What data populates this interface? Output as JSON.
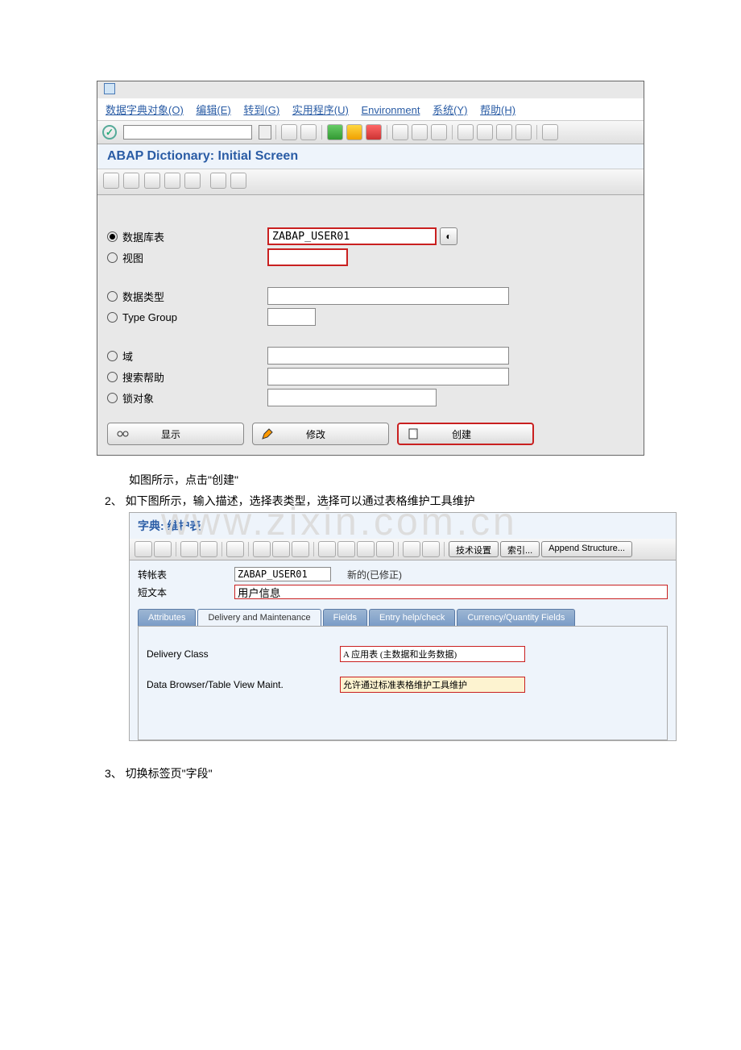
{
  "menubar": {
    "obj": "数据字典对象(O)",
    "edit": "编辑(E)",
    "goto": "转到(G)",
    "util": "实用程序(U)",
    "env": "Environment",
    "sys": "系统(Y)",
    "help": "帮助(H)"
  },
  "page_title": "ABAP Dictionary: Initial Screen",
  "radios": {
    "dbtable": "数据库表",
    "view": "视图",
    "datatype": "数据类型",
    "typegroup": "Type Group",
    "domain": "域",
    "shelp": "搜索帮助",
    "lockobj": "锁对象"
  },
  "fields": {
    "dbtable_value": "ZABAP_USER01"
  },
  "buttons": {
    "display": "显示",
    "change": "修改",
    "create": "创建"
  },
  "instr1": "如图所示，点击\"创建\"",
  "item2": "2、 如下图所示，输入描述，选择表类型，选择可以通过表格维护工具维护",
  "watermark": "www.zixin.com.cn",
  "screen2": {
    "title": "字典: 维护表",
    "toolbar": {
      "tech": "技术设置",
      "index": "索引...",
      "append": "Append Structure..."
    },
    "meta": {
      "table_label": "转帐表",
      "table_value": "ZABAP_USER01",
      "status": "新的(已修正)",
      "shorttext_label": "短文本",
      "shorttext_value": "用户信息"
    },
    "tabs": {
      "attr": "Attributes",
      "delivery": "Delivery and Maintenance",
      "fields": "Fields",
      "entry": "Entry help/check",
      "curr": "Currency/Quantity Fields"
    },
    "form": {
      "delivery_class_label": "Delivery Class",
      "delivery_class_value": "A 应用表 (主数据和业务数据)",
      "maint_label": "Data Browser/Table View Maint.",
      "maint_value": "允许通过标准表格维护工具维护"
    }
  },
  "item3": "3、 切换标签页\"字段\""
}
